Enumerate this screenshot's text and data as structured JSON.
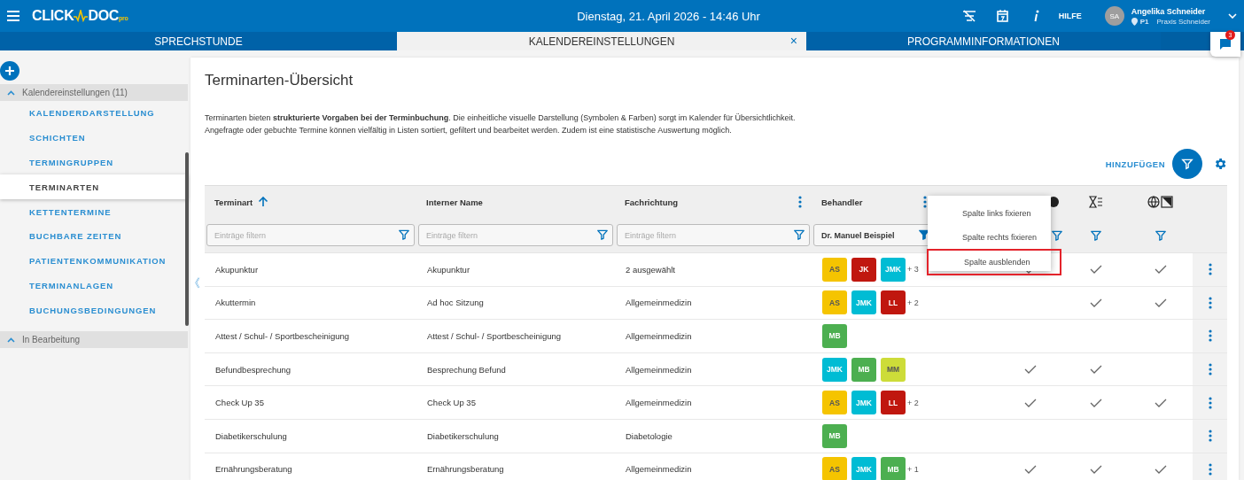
{
  "topbar": {
    "logo": {
      "left": "CLICK",
      "right": "DOC",
      "sup": "pro"
    },
    "datetime": "Dienstag, 21. April 2026 - 14:46 Uhr",
    "help": "HILFE",
    "user": {
      "initials": "SA",
      "name": "Angelika Schneider",
      "location": "P1",
      "practice": "Praxis Schneider"
    }
  },
  "tabs": [
    {
      "label": "SPRECHSTUNDE",
      "selected": false
    },
    {
      "label": "KALENDEREINSTELLUNGEN",
      "selected": true,
      "close": "×"
    },
    {
      "label": "PROGRAMMINFORMATIONEN",
      "selected": false
    }
  ],
  "chat": {
    "badge": "3"
  },
  "sidebar": {
    "collapse": "《",
    "groups": [
      {
        "label": "Kalendereinstellungen (11)",
        "expanded": true,
        "items": [
          {
            "label": "KALENDERDARSTELLUNG",
            "selected": false
          },
          {
            "label": "SCHICHTEN",
            "selected": false
          },
          {
            "label": "TERMINGRUPPEN",
            "selected": false
          },
          {
            "label": "TERMINARTEN",
            "selected": true
          },
          {
            "label": "KETTENTERMINE",
            "selected": false
          },
          {
            "label": "BUCHBARE ZEITEN",
            "selected": false
          },
          {
            "label": "PATIENTENKOMMUNIKATION",
            "selected": false
          },
          {
            "label": "TERMINANLAGEN",
            "selected": false
          },
          {
            "label": "BUCHUNGSBEDINGUNGEN",
            "selected": false
          }
        ]
      },
      {
        "label": "In Bearbeitung",
        "expanded": true
      }
    ]
  },
  "page": {
    "title": "Terminarten-Übersicht",
    "description": [
      "Terminarten bieten **strukturierte Vorgaben bei der Terminbuchung**. Die einheitliche visuelle Darstellung (Symbolen & Farben) sorgt im Kalender für Übersichtlichkeit.",
      "Angefragte oder gebuchte Termine können vielfältig in Listen sortiert, gefiltert und bearbeitet werden. Zudem ist eine statistische Auswertung möglich."
    ],
    "add_label": "HINZUFÜGEN"
  },
  "table": {
    "columns": [
      {
        "label": "Terminart",
        "sorted_ascending": true,
        "menu": false,
        "filter": {
          "placeholder": "Einträge filtern"
        }
      },
      {
        "label": "Interner Name",
        "sorted_ascending": false,
        "menu": false,
        "filter": {
          "placeholder": "Einträge filtern"
        }
      },
      {
        "label": "Fachrichtung",
        "sorted_ascending": false,
        "menu": true,
        "filter": {
          "placeholder": "Einträge filtern"
        }
      },
      {
        "label": "Behandler",
        "sorted_ascending": false,
        "menu": true,
        "filter": {
          "value": "Dr. Manuel Beispiel"
        }
      }
    ],
    "rows": [
      {
        "terminart": "Akupunktur",
        "intern": "Akupunktur",
        "fach": "2 ausgewählt",
        "badges": [
          {
            "text": "AS",
            "color": "#f5c400"
          },
          {
            "text": "JK",
            "color": "#c0170f"
          },
          {
            "text": "JMK",
            "color": "#00bcd4"
          }
        ],
        "more": "+ 3",
        "flags": [
          true,
          true,
          true
        ]
      },
      {
        "terminart": "Akuttermin",
        "intern": "Ad hoc Sitzung",
        "fach": "Allgemeinmedizin",
        "badges": [
          {
            "text": "AS",
            "color": "#f5c400"
          },
          {
            "text": "JMK",
            "color": "#00bcd4"
          },
          {
            "text": "LL",
            "color": "#c0170f"
          }
        ],
        "more": "+ 2",
        "flags": [
          false,
          true,
          true
        ]
      },
      {
        "terminart": "Attest / Schul- / Sportbescheinigung",
        "intern": "Attest / Schul- / Sportbescheinigung",
        "fach": "Allgemeinmedizin",
        "badges": [
          {
            "text": "MB",
            "color": "#4caf50"
          }
        ],
        "flags": [
          false,
          false,
          false
        ]
      },
      {
        "terminart": "Befundbesprechung",
        "intern": "Besprechung Befund",
        "fach": "Allgemeinmedizin",
        "badges": [
          {
            "text": "JMK",
            "color": "#00bcd4"
          },
          {
            "text": "MB",
            "color": "#4caf50"
          },
          {
            "text": "MM",
            "color": "#cddc39"
          }
        ],
        "flags": [
          true,
          true,
          false
        ]
      },
      {
        "terminart": "Check Up 35",
        "intern": "Check Up 35",
        "fach": "Allgemeinmedizin",
        "badges": [
          {
            "text": "AS",
            "color": "#f5c400"
          },
          {
            "text": "JMK",
            "color": "#00bcd4"
          },
          {
            "text": "LL",
            "color": "#c0170f"
          }
        ],
        "more": "+ 2",
        "flags": [
          true,
          true,
          true
        ]
      },
      {
        "terminart": "Diabetikerschulung",
        "intern": "Diabetikerschulung",
        "fach": "Diabetologie",
        "badges": [
          {
            "text": "MB",
            "color": "#4caf50"
          }
        ],
        "flags": [
          false,
          false,
          false
        ]
      },
      {
        "terminart": "Ernährungsberatung",
        "intern": "Ernährungsberatung",
        "fach": "Allgemeinmedizin",
        "badges": [
          {
            "text": "AS",
            "color": "#f5c400"
          },
          {
            "text": "JMK",
            "color": "#00bcd4"
          },
          {
            "text": "MB",
            "color": "#4caf50"
          }
        ],
        "more": "+ 1",
        "flags": [
          true,
          true,
          true
        ]
      }
    ]
  },
  "column_menu": [
    {
      "label": "Spalte links fixieren",
      "highlighted": false
    },
    {
      "label": "Spalte rechts fixieren",
      "highlighted": false
    },
    {
      "label": "Spalte ausblenden",
      "highlighted": true
    }
  ]
}
